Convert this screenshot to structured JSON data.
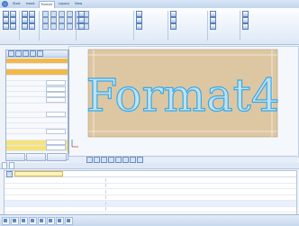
{
  "ribbon": {
    "tabs": [
      "Start",
      "Insert",
      "Format",
      "Layout",
      "View"
    ],
    "active_tab": 2
  },
  "canvas": {
    "text": "Format4",
    "text_color": "#bfe2f2",
    "outline_color": "#3aa8e6",
    "board_color": "#ddc7a2"
  },
  "lower_panel": {
    "rows": [
      "",
      "",
      "",
      "",
      "",
      "",
      "",
      ""
    ]
  },
  "status": {
    "items": [
      "",
      "",
      "",
      "",
      "",
      "",
      "",
      "",
      "",
      ""
    ]
  }
}
